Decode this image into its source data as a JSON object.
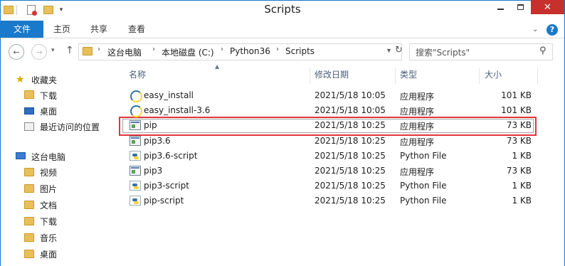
{
  "window": {
    "title": "Scripts"
  },
  "ribbon": {
    "tabs": [
      "文件",
      "主页",
      "共享",
      "查看"
    ]
  },
  "address": {
    "crumbs": [
      "这台电脑",
      "本地磁盘 (C:)",
      "Python36",
      "Scripts"
    ],
    "search_placeholder": "搜索\"Scripts\""
  },
  "nav": {
    "favorites": {
      "label": "收藏夹",
      "items": [
        "下载",
        "桌面",
        "最近访问的位置"
      ]
    },
    "computer": {
      "label": "这台电脑",
      "items": [
        "视频",
        "图片",
        "文档",
        "下载",
        "音乐",
        "桌面"
      ]
    }
  },
  "columns": {
    "name": "名称",
    "date": "修改日期",
    "type": "类型",
    "size": "大小"
  },
  "files": [
    {
      "name": "easy_install",
      "date": "2021/5/18 10:05",
      "type": "应用程序",
      "size": "101 KB",
      "icon": "easy-install-icon"
    },
    {
      "name": "easy_install-3.6",
      "date": "2021/5/18 10:05",
      "type": "应用程序",
      "size": "101 KB",
      "icon": "easy-install-icon"
    },
    {
      "name": "pip",
      "date": "2021/5/18 10:25",
      "type": "应用程序",
      "size": "73 KB",
      "icon": "exe-icon"
    },
    {
      "name": "pip3.6",
      "date": "2021/5/18 10:25",
      "type": "应用程序",
      "size": "73 KB",
      "icon": "exe-icon"
    },
    {
      "name": "pip3.6-script",
      "date": "2021/5/18 10:25",
      "type": "Python File",
      "size": "1 KB",
      "icon": "python-file-icon"
    },
    {
      "name": "pip3",
      "date": "2021/5/18 10:25",
      "type": "应用程序",
      "size": "73 KB",
      "icon": "exe-icon"
    },
    {
      "name": "pip3-script",
      "date": "2021/5/18 10:25",
      "type": "Python File",
      "size": "1 KB",
      "icon": "python-file-icon"
    },
    {
      "name": "pip-script",
      "date": "2021/5/18 10:25",
      "type": "Python File",
      "size": "1 KB",
      "icon": "python-file-icon"
    }
  ],
  "colors": {
    "accent": "#1979ca",
    "close": "#c7302c",
    "highlight": "#e2353a"
  }
}
